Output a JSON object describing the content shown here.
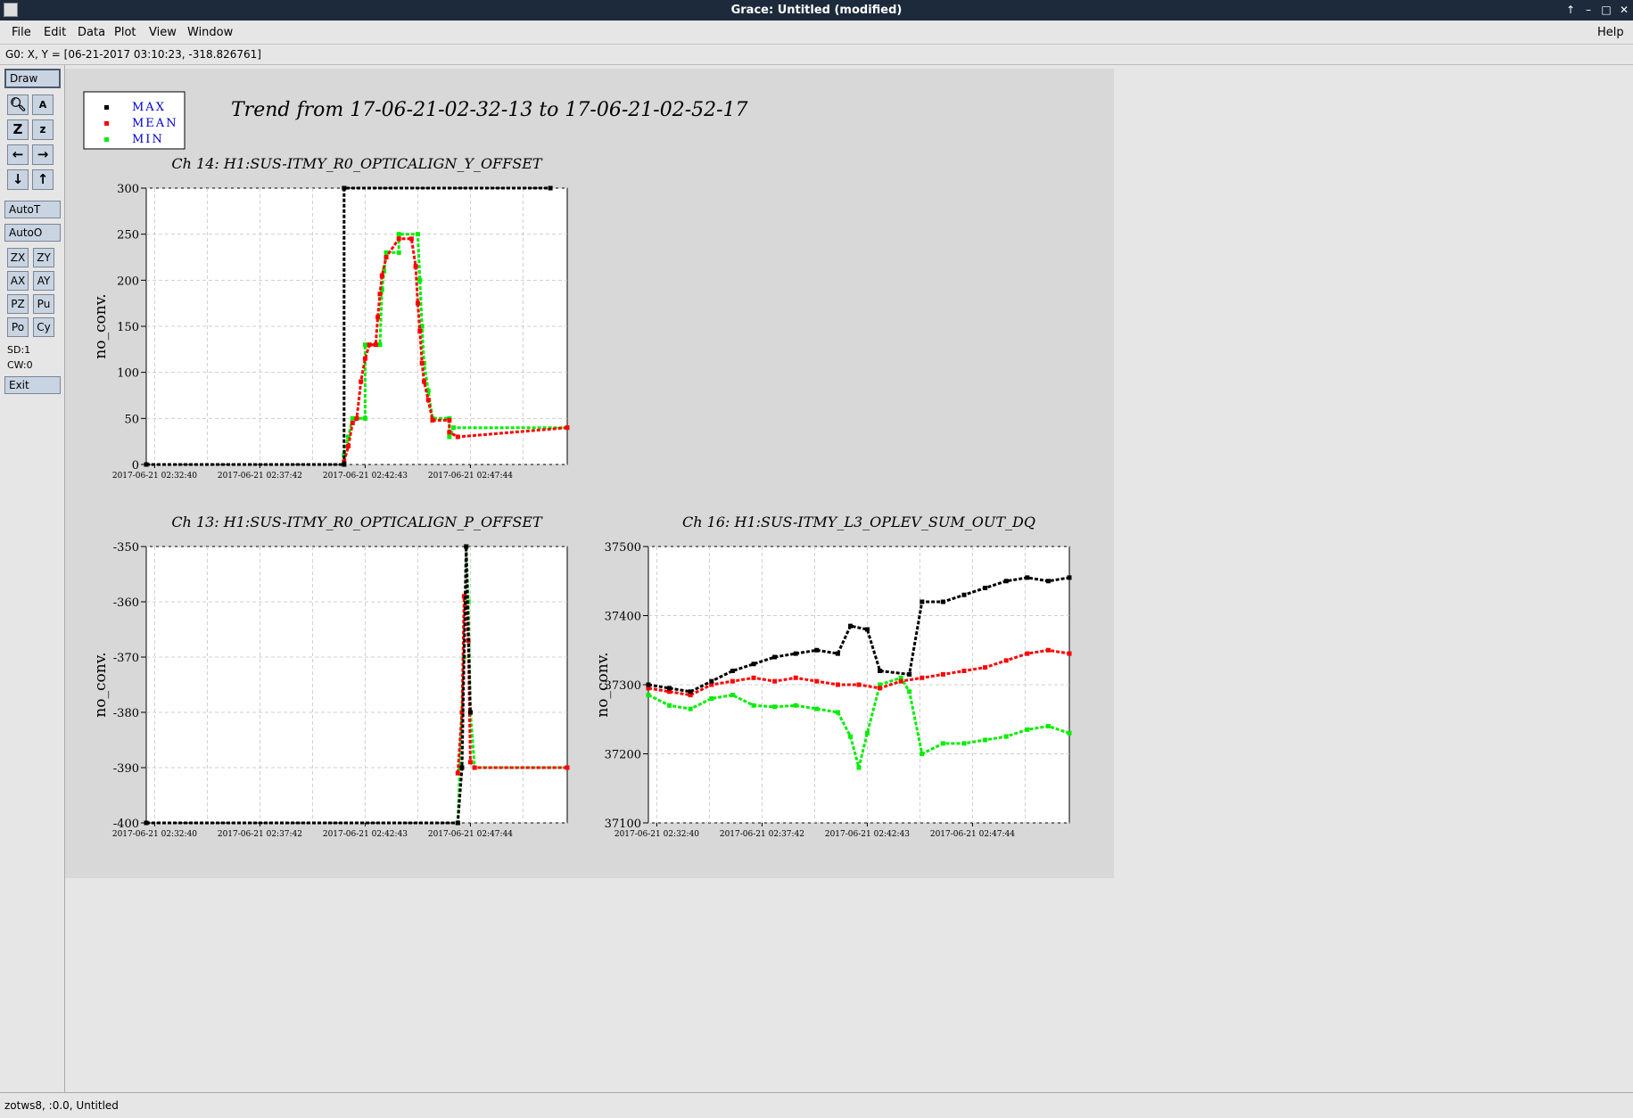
{
  "window": {
    "title": "Grace: Untitled (modified)",
    "controls": [
      "↑",
      "–",
      "□",
      "✕"
    ]
  },
  "menu": {
    "file": "File",
    "edit": "Edit",
    "data": "Data",
    "plot": "Plot",
    "view": "View",
    "window": "Window",
    "help": "Help"
  },
  "status": {
    "coords": "G0: X, Y = [06-21-2017 03:10:23, -318.826761]"
  },
  "toolbar": {
    "draw": "Draw",
    "autot": "AutoT",
    "autoo": "AutoO",
    "zx": "ZX",
    "zy": "ZY",
    "ax": "AX",
    "ay": "AY",
    "pz": "PZ",
    "pu": "Pu",
    "po": "Po",
    "cy": "Cy",
    "sd": "SD:1",
    "cw": "CW:0",
    "exit": "Exit"
  },
  "footer": {
    "text": "zotws8, :0.0, Untitled"
  },
  "page_title": "Trend from 17-06-21-02-32-13 to 17-06-21-02-52-17",
  "legend": [
    {
      "name": "MAX",
      "color": "#000000"
    },
    {
      "name": "MEAN",
      "color": "#ff0000"
    },
    {
      "name": "MIN",
      "color": "#00ee00"
    }
  ],
  "colors": {
    "max": "#000000",
    "mean": "#ff0000",
    "min": "#00ee00",
    "legend_text": "#0000cc"
  },
  "chart_data": [
    {
      "type": "scatter",
      "title": "Ch 14: H1:SUS-ITMY_R0_OPTICALIGN_Y_OFFSET",
      "ylabel": "no_conv.",
      "ylim": [
        0,
        300
      ],
      "yticks": [
        0,
        50,
        100,
        150,
        200,
        250,
        300
      ],
      "xticks": [
        "2017-06-21 02:32:40",
        "2017-06-21 02:37:42",
        "2017-06-21 02:42:43",
        "2017-06-21 02:47:44"
      ],
      "series": [
        {
          "name": "MAX",
          "points": [
            [
              0,
              0
            ],
            [
              0.47,
              0
            ],
            [
              0.47,
              300
            ],
            [
              0.96,
              300
            ]
          ]
        },
        {
          "name": "MEAN",
          "points": [
            [
              0.47,
              3
            ],
            [
              0.48,
              20
            ],
            [
              0.49,
              45
            ],
            [
              0.5,
              50
            ],
            [
              0.51,
              90
            ],
            [
              0.52,
              115
            ],
            [
              0.53,
              130
            ],
            [
              0.545,
              130
            ],
            [
              0.55,
              160
            ],
            [
              0.555,
              185
            ],
            [
              0.56,
              205
            ],
            [
              0.57,
              225
            ],
            [
              0.6,
              245
            ],
            [
              0.63,
              245
            ],
            [
              0.64,
              215
            ],
            [
              0.645,
              175
            ],
            [
              0.65,
              145
            ],
            [
              0.655,
              110
            ],
            [
              0.66,
              90
            ],
            [
              0.67,
              70
            ],
            [
              0.68,
              48
            ],
            [
              0.72,
              48
            ],
            [
              0.72,
              35
            ],
            [
              0.74,
              30
            ],
            [
              1,
              40
            ]
          ]
        },
        {
          "name": "MIN",
          "points": [
            [
              0,
              0
            ],
            [
              0.47,
              0
            ],
            [
              0.47,
              10
            ],
            [
              0.48,
              30
            ],
            [
              0.49,
              50
            ],
            [
              0.52,
              50
            ],
            [
              0.52,
              130
            ],
            [
              0.555,
              130
            ],
            [
              0.56,
              190
            ],
            [
              0.565,
              210
            ],
            [
              0.57,
              230
            ],
            [
              0.6,
              230
            ],
            [
              0.6,
              250
            ],
            [
              0.645,
              250
            ],
            [
              0.65,
              200
            ],
            [
              0.655,
              150
            ],
            [
              0.66,
              110
            ],
            [
              0.67,
              80
            ],
            [
              0.68,
              50
            ],
            [
              0.72,
              50
            ],
            [
              0.72,
              30
            ],
            [
              0.73,
              40
            ],
            [
              1,
              40
            ]
          ]
        }
      ]
    },
    {
      "type": "scatter",
      "title": "Ch 13: H1:SUS-ITMY_R0_OPTICALIGN_P_OFFSET",
      "ylabel": "no_conv.",
      "ylim": [
        -400,
        -350
      ],
      "yticks": [
        -400,
        -390,
        -380,
        -370,
        -360,
        -350
      ],
      "xticks": [
        "2017-06-21 02:32:40",
        "2017-06-21 02:37:42",
        "2017-06-21 02:42:43",
        "2017-06-21 02:47:44"
      ],
      "series": [
        {
          "name": "MAX",
          "points": [
            [
              0,
              -400
            ],
            [
              0.74,
              -400
            ],
            [
              0.75,
              -390
            ],
            [
              0.76,
              -350
            ],
            [
              0.77,
              -380
            ]
          ]
        },
        {
          "name": "MEAN",
          "points": [
            [
              0.74,
              -391
            ],
            [
              0.75,
              -380
            ],
            [
              0.755,
              -359
            ],
            [
              0.76,
              -361
            ],
            [
              0.765,
              -367
            ],
            [
              0.77,
              -389
            ],
            [
              0.78,
              -390
            ],
            [
              1,
              -390
            ]
          ]
        },
        {
          "name": "MIN",
          "points": [
            [
              0,
              -400
            ],
            [
              0.74,
              -400
            ],
            [
              0.745,
              -390
            ],
            [
              0.75,
              -380
            ],
            [
              0.755,
              -370
            ],
            [
              0.76,
              -350
            ],
            [
              0.765,
              -360
            ],
            [
              0.77,
              -380
            ],
            [
              0.78,
              -390
            ],
            [
              1,
              -390
            ]
          ]
        }
      ]
    },
    {
      "type": "scatter",
      "title": "Ch 16: H1:SUS-ITMY_L3_OPLEV_SUM_OUT_DQ",
      "ylabel": "no_conv.",
      "ylim": [
        37100,
        37500
      ],
      "yticks": [
        37100,
        37200,
        37300,
        37400,
        37500
      ],
      "xticks": [
        "2017-06-21 02:32:40",
        "2017-06-21 02:37:42",
        "2017-06-21 02:42:43",
        "2017-06-21 02:47:44"
      ],
      "series": [
        {
          "name": "MAX",
          "points": [
            [
              0,
              37300
            ],
            [
              0.05,
              37295
            ],
            [
              0.1,
              37290
            ],
            [
              0.15,
              37305
            ],
            [
              0.2,
              37320
            ],
            [
              0.25,
              37330
            ],
            [
              0.3,
              37340
            ],
            [
              0.35,
              37345
            ],
            [
              0.4,
              37350
            ],
            [
              0.45,
              37345
            ],
            [
              0.48,
              37385
            ],
            [
              0.52,
              37380
            ],
            [
              0.55,
              37320
            ],
            [
              0.62,
              37315
            ],
            [
              0.65,
              37420
            ],
            [
              0.7,
              37420
            ],
            [
              0.75,
              37430
            ],
            [
              0.8,
              37440
            ],
            [
              0.85,
              37450
            ],
            [
              0.9,
              37455
            ],
            [
              0.95,
              37450
            ],
            [
              1,
              37455
            ]
          ]
        },
        {
          "name": "MEAN",
          "points": [
            [
              0,
              37295
            ],
            [
              0.05,
              37290
            ],
            [
              0.1,
              37285
            ],
            [
              0.15,
              37300
            ],
            [
              0.2,
              37305
            ],
            [
              0.25,
              37310
            ],
            [
              0.3,
              37305
            ],
            [
              0.35,
              37310
            ],
            [
              0.4,
              37305
            ],
            [
              0.45,
              37300
            ],
            [
              0.5,
              37300
            ],
            [
              0.55,
              37295
            ],
            [
              0.6,
              37305
            ],
            [
              0.65,
              37310
            ],
            [
              0.7,
              37315
            ],
            [
              0.75,
              37320
            ],
            [
              0.8,
              37325
            ],
            [
              0.85,
              37335
            ],
            [
              0.9,
              37345
            ],
            [
              0.95,
              37350
            ],
            [
              1,
              37345
            ]
          ]
        },
        {
          "name": "MIN",
          "points": [
            [
              0,
              37285
            ],
            [
              0.05,
              37270
            ],
            [
              0.1,
              37265
            ],
            [
              0.15,
              37280
            ],
            [
              0.2,
              37285
            ],
            [
              0.25,
              37270
            ],
            [
              0.3,
              37268
            ],
            [
              0.35,
              37270
            ],
            [
              0.4,
              37265
            ],
            [
              0.45,
              37260
            ],
            [
              0.48,
              37225
            ],
            [
              0.5,
              37180
            ],
            [
              0.52,
              37230
            ],
            [
              0.55,
              37300
            ],
            [
              0.6,
              37310
            ],
            [
              0.62,
              37290
            ],
            [
              0.65,
              37200
            ],
            [
              0.7,
              37215
            ],
            [
              0.75,
              37215
            ],
            [
              0.8,
              37220
            ],
            [
              0.85,
              37225
            ],
            [
              0.9,
              37235
            ],
            [
              0.95,
              37240
            ],
            [
              1,
              37230
            ]
          ]
        }
      ]
    }
  ]
}
